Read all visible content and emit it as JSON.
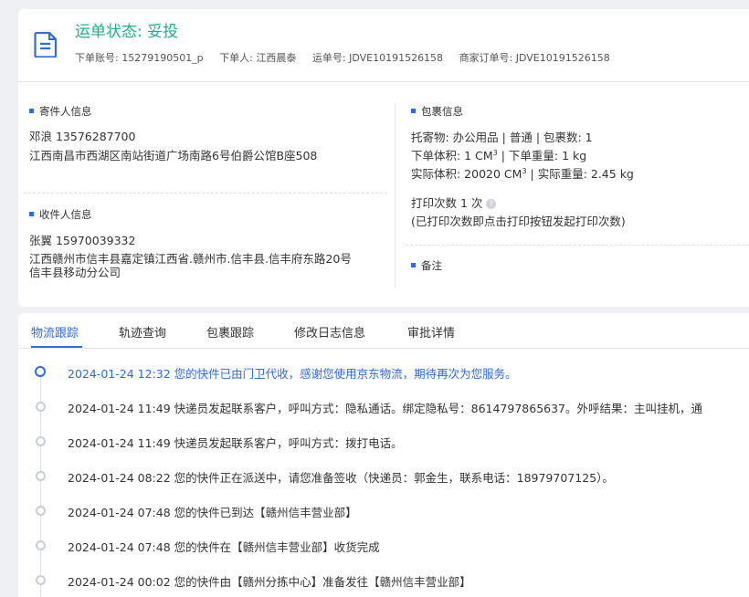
{
  "header": {
    "status_label": "运单状态: 妥投",
    "order_account": "下单账号: 15279190501_p",
    "orderer": "下单人: 江西晨泰",
    "waybill_no": "运单号: JDVE10191526158",
    "merchant_order_no": "商家订单号: JDVE10191526158",
    "icon": "document-icon"
  },
  "sender": {
    "title": "寄件人信息",
    "name_phone": "邓浪   13576287700",
    "address": "江西南昌市西湖区南站街道广场南路6号伯爵公馆B座508"
  },
  "receiver": {
    "title": "收件人信息",
    "name_phone": "张翼   15970039332",
    "address_line1": "江西赣州市信丰县嘉定镇江西省.赣州市.信丰县.信丰府东路20号",
    "address_line2": "信丰县移动分公司"
  },
  "package": {
    "title": "包裹信息",
    "goods": "托寄物:  办公用品 | 普通  |  包裹数:  1",
    "order_volume_label": "下单体积:   1 CM",
    "order_volume_unit_exp": "3",
    "order_weight": "|   下单重量:   1 kg",
    "actual_volume_label": "实际体积:   20020 CM",
    "actual_volume_unit_exp": "3",
    "actual_weight": "|   实际重量:   2.45 kg",
    "print_count": "打印次数   1 次",
    "print_hint": "(已打印次数即点击打印按钮发起打印次数)",
    "help_icon": "question-icon",
    "help_glyph": "?"
  },
  "remarks": {
    "title": "备注"
  },
  "tabs": [
    {
      "label": "物流跟踪",
      "active": true
    },
    {
      "label": "轨迹查询",
      "active": false
    },
    {
      "label": "包裹跟踪",
      "active": false
    },
    {
      "label": "修改日志信息",
      "active": false
    },
    {
      "label": "审批详情",
      "active": false
    }
  ],
  "timeline": [
    {
      "text": "2024-01-24 12:32 您的快件已由门卫代收，感谢您使用京东物流，期待再次为您服务。",
      "current": true
    },
    {
      "text": "2024-01-24 11:49 快递员发起联系客户，呼叫方式：隐私通话。绑定隐私号：8614797865637。外呼结果：主叫挂机，通",
      "current": false
    },
    {
      "text": "2024-01-24 11:49 快递员发起联系客户，呼叫方式：拨打电话。",
      "current": false
    },
    {
      "text": "2024-01-24 08:22 您的快件正在派送中，请您准备签收（快递员：郭金生，联系电话：18979707125）。",
      "current": false
    },
    {
      "text": "2024-01-24 07:48 您的快件已到达【赣州信丰营业部】",
      "current": false
    },
    {
      "text": "2024-01-24 07:48 您的快件在【赣州信丰营业部】收货完成",
      "current": false
    },
    {
      "text": "2024-01-24 00:02 您的快件由【赣州分拣中心】准备发往【赣州信丰营业部】",
      "current": false
    }
  ],
  "colors": {
    "accent": "#2d6be4",
    "status_green": "#1fae8f",
    "background": "#eef0f4"
  }
}
